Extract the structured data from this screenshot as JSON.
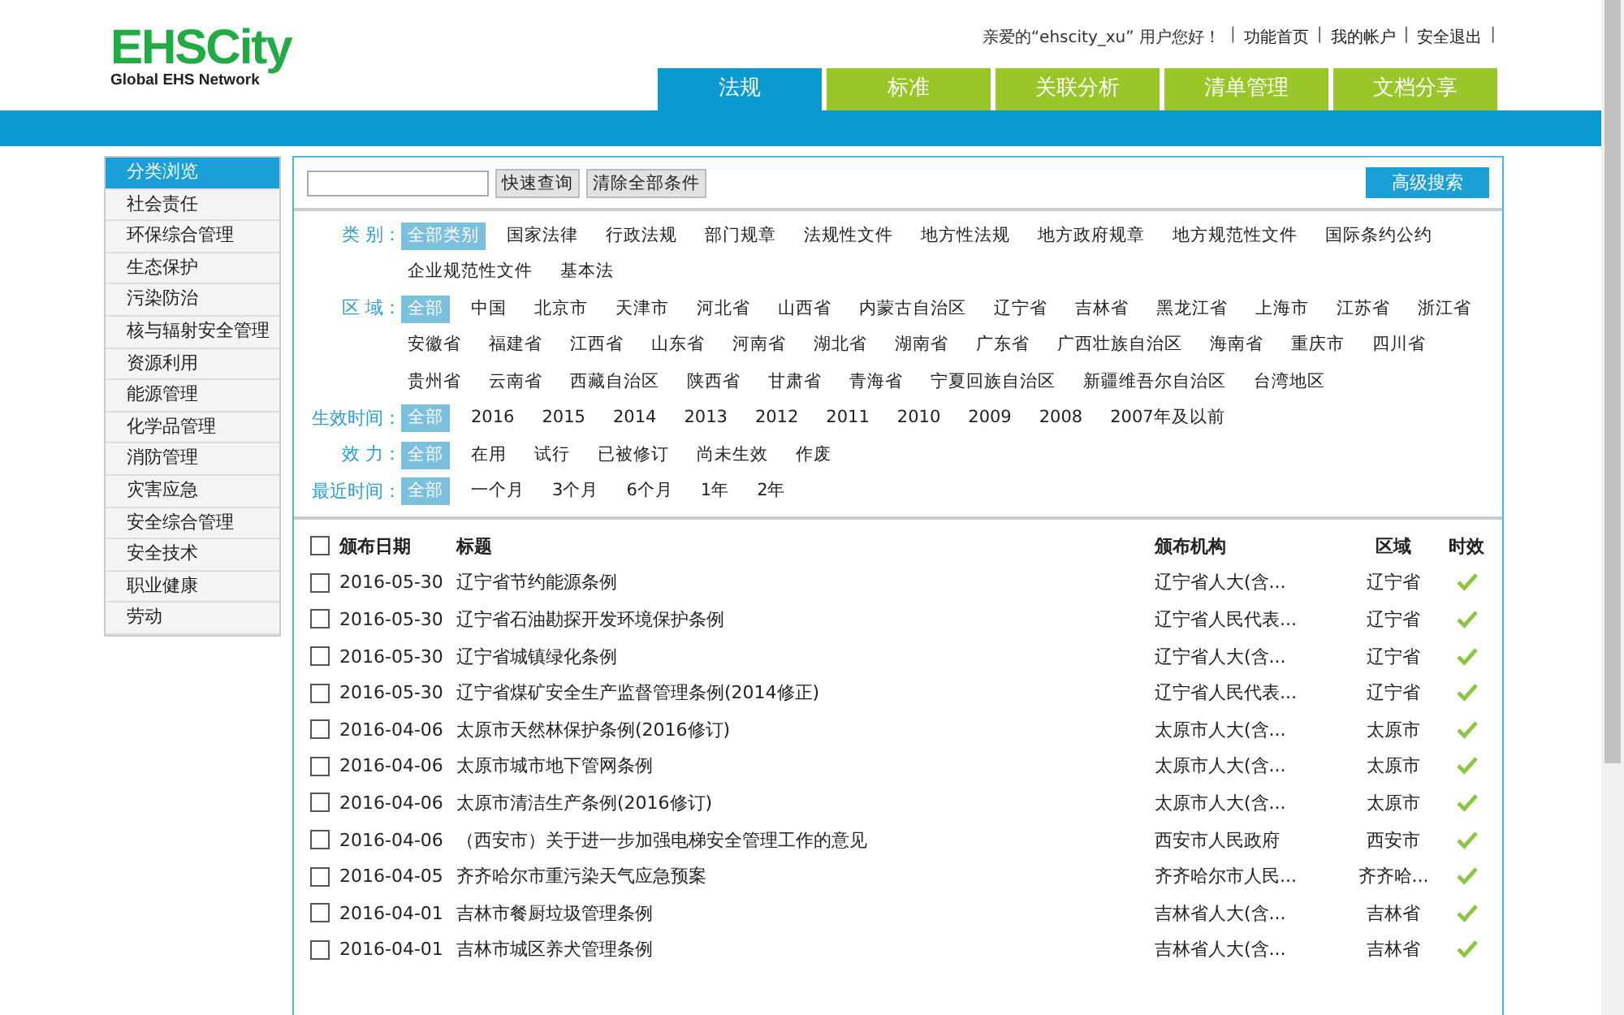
{
  "logo": {
    "name": "EHSCity",
    "tagline": "Global EHS Network"
  },
  "top_links": [
    {
      "kind": "text",
      "label": "亲爱的“ehscity_xu” 用户您好！"
    },
    {
      "kind": "separator",
      "label": "|"
    },
    {
      "kind": "link",
      "label": "功能首页"
    },
    {
      "kind": "separator",
      "label": "|"
    },
    {
      "kind": "link",
      "label": "我的帐户"
    },
    {
      "kind": "separator",
      "label": "|"
    },
    {
      "kind": "link",
      "label": "安全退出"
    },
    {
      "kind": "separator",
      "label": "|"
    }
  ],
  "nav_tabs": [
    {
      "label": "法规",
      "selected": true
    },
    {
      "label": "标准",
      "selected": false
    },
    {
      "label": "关联分析",
      "selected": false
    },
    {
      "label": "清单管理",
      "selected": false
    },
    {
      "label": "文档分享",
      "selected": false
    }
  ],
  "sidebar": {
    "items": [
      {
        "label": "分类浏览",
        "selected": true
      },
      {
        "label": "社会责任",
        "selected": false
      },
      {
        "label": "环保综合管理",
        "selected": false
      },
      {
        "label": "生态保护",
        "selected": false
      },
      {
        "label": "污染防治",
        "selected": false
      },
      {
        "label": "核与辐射安全管理",
        "selected": false
      },
      {
        "label": "资源利用",
        "selected": false
      },
      {
        "label": "能源管理",
        "selected": false
      },
      {
        "label": "化学品管理",
        "selected": false
      },
      {
        "label": "消防管理",
        "selected": false
      },
      {
        "label": "灾害应急",
        "selected": false
      },
      {
        "label": "安全综合管理",
        "selected": false
      },
      {
        "label": "安全技术",
        "selected": false
      },
      {
        "label": "职业健康",
        "selected": false
      },
      {
        "label": "劳动",
        "selected": false
      }
    ]
  },
  "search": {
    "quick_button": "快速查询",
    "clear_button": "清除全部条件",
    "advanced_button": "高级搜索"
  },
  "filters": [
    {
      "label": "类 别：",
      "options": [
        {
          "label": "全部类别",
          "selected": true
        },
        {
          "label": "国家法律",
          "selected": false
        },
        {
          "label": "行政法规",
          "selected": false
        },
        {
          "label": "部门规章",
          "selected": false
        },
        {
          "label": "法规性文件",
          "selected": false
        },
        {
          "label": "地方性法规",
          "selected": false
        },
        {
          "label": "地方政府规章",
          "selected": false
        },
        {
          "label": "地方规范性文件",
          "selected": false
        },
        {
          "label": "国际条约公约",
          "selected": false
        },
        {
          "label": "企业规范性文件",
          "selected": false
        },
        {
          "label": "基本法",
          "selected": false
        }
      ]
    },
    {
      "label": "区 域：",
      "options": [
        {
          "label": "全部",
          "selected": true
        },
        {
          "label": "中国",
          "selected": false
        },
        {
          "label": "北京市",
          "selected": false
        },
        {
          "label": "天津市",
          "selected": false
        },
        {
          "label": "河北省",
          "selected": false
        },
        {
          "label": "山西省",
          "selected": false
        },
        {
          "label": "内蒙古自治区",
          "selected": false
        },
        {
          "label": "辽宁省",
          "selected": false
        },
        {
          "label": "吉林省",
          "selected": false
        },
        {
          "label": "黑龙江省",
          "selected": false
        },
        {
          "label": "上海市",
          "selected": false
        },
        {
          "label": "江苏省",
          "selected": false
        },
        {
          "label": "浙江省",
          "selected": false
        },
        {
          "label": "安徽省",
          "selected": false
        },
        {
          "label": "福建省",
          "selected": false
        },
        {
          "label": "江西省",
          "selected": false
        },
        {
          "label": "山东省",
          "selected": false
        },
        {
          "label": "河南省",
          "selected": false
        },
        {
          "label": "湖北省",
          "selected": false
        },
        {
          "label": "湖南省",
          "selected": false
        },
        {
          "label": "广东省",
          "selected": false
        },
        {
          "label": "广西壮族自治区",
          "selected": false
        },
        {
          "label": "海南省",
          "selected": false
        },
        {
          "label": "重庆市",
          "selected": false
        },
        {
          "label": "四川省",
          "selected": false
        },
        {
          "label": "贵州省",
          "selected": false
        },
        {
          "label": "云南省",
          "selected": false
        },
        {
          "label": "西藏自治区",
          "selected": false
        },
        {
          "label": "陕西省",
          "selected": false
        },
        {
          "label": "甘肃省",
          "selected": false
        },
        {
          "label": "青海省",
          "selected": false
        },
        {
          "label": "宁夏回族自治区",
          "selected": false
        },
        {
          "label": "新疆维吾尔自治区",
          "selected": false
        },
        {
          "label": "台湾地区",
          "selected": false
        }
      ]
    },
    {
      "label": "生效时间：",
      "options": [
        {
          "label": "全部",
          "selected": true
        },
        {
          "label": "2016",
          "selected": false
        },
        {
          "label": "2015",
          "selected": false
        },
        {
          "label": "2014",
          "selected": false
        },
        {
          "label": "2013",
          "selected": false
        },
        {
          "label": "2012",
          "selected": false
        },
        {
          "label": "2011",
          "selected": false
        },
        {
          "label": "2010",
          "selected": false
        },
        {
          "label": "2009",
          "selected": false
        },
        {
          "label": "2008",
          "selected": false
        },
        {
          "label": "2007年及以前",
          "selected": false
        }
      ]
    },
    {
      "label": "效 力：",
      "options": [
        {
          "label": "全部",
          "selected": true
        },
        {
          "label": "在用",
          "selected": false
        },
        {
          "label": "试行",
          "selected": false
        },
        {
          "label": "已被修订",
          "selected": false
        },
        {
          "label": "尚未生效",
          "selected": false
        },
        {
          "label": "作废",
          "selected": false
        }
      ]
    },
    {
      "label": "最近时间：",
      "options": [
        {
          "label": "全部",
          "selected": true
        },
        {
          "label": "一个月",
          "selected": false
        },
        {
          "label": "3个月",
          "selected": false
        },
        {
          "label": "6个月",
          "selected": false
        },
        {
          "label": "1年",
          "selected": false
        },
        {
          "label": "2年",
          "selected": false
        }
      ]
    }
  ],
  "table": {
    "select_all_checked": false,
    "columns": [
      "颁布日期",
      "标题",
      "颁布机构",
      "区域",
      "时效"
    ],
    "rows": [
      {
        "checked": false,
        "date": "2016-05-30",
        "title": "辽宁省节约能源条例",
        "agency": "辽宁省人大(含...",
        "region": "辽宁省",
        "valid": true
      },
      {
        "checked": false,
        "date": "2016-05-30",
        "title": "辽宁省石油勘探开发环境保护条例",
        "agency": "辽宁省人民代表...",
        "region": "辽宁省",
        "valid": true
      },
      {
        "checked": false,
        "date": "2016-05-30",
        "title": "辽宁省城镇绿化条例",
        "agency": "辽宁省人大(含...",
        "region": "辽宁省",
        "valid": true
      },
      {
        "checked": false,
        "date": "2016-05-30",
        "title": "辽宁省煤矿安全生产监督管理条例(2014修正)",
        "agency": "辽宁省人民代表...",
        "region": "辽宁省",
        "valid": true
      },
      {
        "checked": false,
        "date": "2016-04-06",
        "title": "太原市天然林保护条例(2016修订)",
        "agency": "太原市人大(含...",
        "region": "太原市",
        "valid": true
      },
      {
        "checked": false,
        "date": "2016-04-06",
        "title": "太原市城市地下管网条例",
        "agency": "太原市人大(含...",
        "region": "太原市",
        "valid": true
      },
      {
        "checked": false,
        "date": "2016-04-06",
        "title": "太原市清洁生产条例(2016修订)",
        "agency": "太原市人大(含...",
        "region": "太原市",
        "valid": true
      },
      {
        "checked": false,
        "date": "2016-04-06",
        "title": "（西安市）关于进一步加强电梯安全管理工作的意见",
        "agency": "西安市人民政府",
        "region": "西安市",
        "valid": true
      },
      {
        "checked": false,
        "date": "2016-04-05",
        "title": "齐齐哈尔市重污染天气应急预案",
        "agency": "齐齐哈尔市人民...",
        "region": "齐齐哈...",
        "valid": true
      },
      {
        "checked": false,
        "date": "2016-04-01",
        "title": "吉林市餐厨垃圾管理条例",
        "agency": "吉林省人大(含...",
        "region": "吉林省",
        "valid": true
      },
      {
        "checked": false,
        "date": "2016-04-01",
        "title": "吉林市城区养犬管理条例",
        "agency": "吉林省人大(含...",
        "region": "吉林省",
        "valid": true
      }
    ]
  }
}
